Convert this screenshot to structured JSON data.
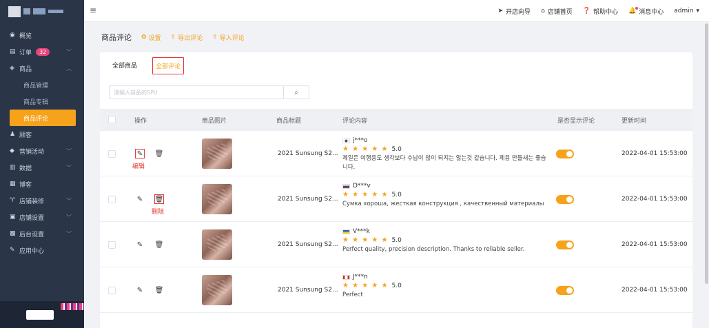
{
  "sidebar": {
    "items": [
      {
        "icon": "dashboard-icon",
        "glyph": "◉",
        "label": "概览"
      },
      {
        "icon": "orders-icon",
        "glyph": "▤",
        "label": "订单",
        "badge": "32",
        "arrow": true
      },
      {
        "icon": "goods-icon",
        "glyph": "◈",
        "label": "商品",
        "arrow": true,
        "expanded": true
      }
    ],
    "sub_items": [
      {
        "label": "商品管理"
      },
      {
        "label": "商品专辑"
      },
      {
        "label": "商品评论",
        "active": true
      }
    ],
    "items2": [
      {
        "icon": "customer-icon",
        "glyph": "♟",
        "label": "顾客"
      },
      {
        "icon": "marketing-icon",
        "glyph": "◆",
        "label": "营销活动",
        "arrow": true
      },
      {
        "icon": "data-icon",
        "glyph": "▥",
        "label": "数据",
        "arrow": true
      },
      {
        "icon": "blog-icon",
        "glyph": "▦",
        "label": "博客"
      },
      {
        "icon": "decor-icon",
        "glyph": "♈",
        "label": "店铺装修",
        "arrow": true
      },
      {
        "icon": "store-settings-icon",
        "glyph": "▣",
        "label": "店铺设置",
        "arrow": true
      },
      {
        "icon": "admin-settings-icon",
        "glyph": "▩",
        "label": "后台设置",
        "arrow": true
      },
      {
        "icon": "app-center-icon",
        "glyph": "✎",
        "label": "应用中心"
      }
    ]
  },
  "topbar": {
    "links": [
      {
        "icon": "send-icon",
        "glyph": "➤",
        "label": "开店向导"
      },
      {
        "icon": "home-icon",
        "glyph": "⌂",
        "label": "店铺首页"
      },
      {
        "icon": "help-icon",
        "glyph": "❓",
        "label": "帮助中心"
      },
      {
        "icon": "bell-icon",
        "glyph": "🔔",
        "label": "消息中心"
      }
    ],
    "user": "admin"
  },
  "page": {
    "title": "商品评论",
    "actions": [
      {
        "icon": "gear-icon",
        "glyph": "✿",
        "label": "设置"
      },
      {
        "icon": "export-icon",
        "glyph": "⇪",
        "label": "导出评论"
      },
      {
        "icon": "import-icon",
        "glyph": "⇪",
        "label": "导入评论"
      }
    ]
  },
  "tabs": [
    {
      "label": "全部商品"
    },
    {
      "label": "全部评论",
      "active": true
    }
  ],
  "search": {
    "placeholder": "请输入商品的SPU"
  },
  "table": {
    "columns": [
      "操作",
      "商品图片",
      "商品标题",
      "评论内容",
      "是否显示评论",
      "更新时间"
    ],
    "rows": [
      {
        "title": "2021 Sunsung S2...",
        "flag": "kr",
        "user": "j***o",
        "rating": "5.0",
        "text": "제일은 여행용도 생각보다 수납이 많이 되지는 않는것 같습니다. 제용 만들새는 좋습니다.",
        "show": true,
        "date": "2022-04-01 15:53:00"
      },
      {
        "title": "2021 Sunsung S2...",
        "flag": "ru",
        "user": "D***v",
        "rating": "5.0",
        "text": "Сумка хороша, жесткая конструкция , качественный материалы",
        "show": true,
        "date": "2022-04-01 15:53:00"
      },
      {
        "title": "2021 Sunsung S2...",
        "flag": "ua",
        "user": "V***k",
        "rating": "5.0",
        "text": "Perfect quality, precision description. Thanks to reliable seller.",
        "show": true,
        "date": "2022-04-01 15:53:00"
      },
      {
        "title": "2021 Sunsung S2...",
        "flag": "ca",
        "user": "J***n",
        "rating": "5.0",
        "text": "Perfect",
        "show": true,
        "date": "2022-04-01 15:53:00"
      }
    ]
  },
  "annotations": {
    "edit": "编辑",
    "delete": "删除"
  },
  "stars": "★ ★ ★ ★ ★",
  "colors": {
    "accent": "#f6a21b",
    "sidebar": "#2b3548",
    "annotation": "#e53935"
  }
}
